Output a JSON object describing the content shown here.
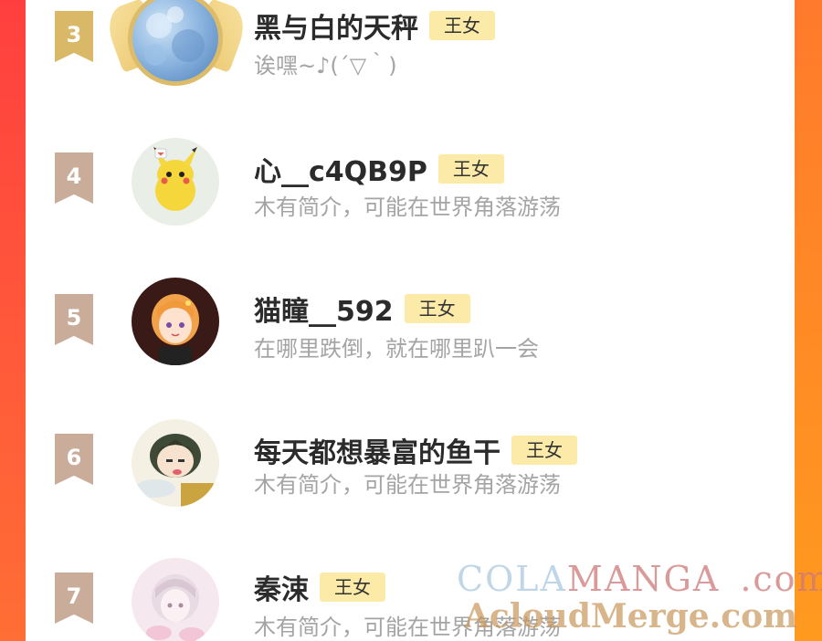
{
  "colors": {
    "panel": "#ffffff",
    "rank_gold": "#d9b867",
    "rank_plain": "#c9ad9a",
    "badge_bg": "#fbeaa8",
    "bio_text": "#a4a4a4"
  },
  "entries": [
    {
      "rank": "3",
      "name": "黑与白的天秤",
      "badge": "王女",
      "bio": "诶嘿~♪(´▽｀)",
      "avatar": "blue-watercolor-avatar",
      "frame": "gold-wing-frame"
    },
    {
      "rank": "4",
      "name": "心__c4QB9P",
      "badge": "王女",
      "bio": "木有简介，可能在世界角落游荡",
      "avatar": "pikachu-avatar"
    },
    {
      "rank": "5",
      "name": "猫瞳__592",
      "badge": "王女",
      "bio": "在哪里跌倒，就在哪里趴一会",
      "avatar": "orange-hair-girl-avatar"
    },
    {
      "rank": "6",
      "name": "每天都想暴富的鱼干",
      "badge": "王女",
      "bio": "木有简介，可能在世界角落游荡",
      "avatar": "green-hair-boy-avatar"
    },
    {
      "rank": "7",
      "name": "秦涑",
      "badge": "王女",
      "bio": "木有简介，可能在世界角落游荡",
      "avatar": "pale-girl-avatar"
    }
  ],
  "watermark": {
    "line1_a": "COLA",
    "line1_b": "MANGA",
    "line1_c": ".com",
    "line2": "AcloudMerge.com"
  }
}
